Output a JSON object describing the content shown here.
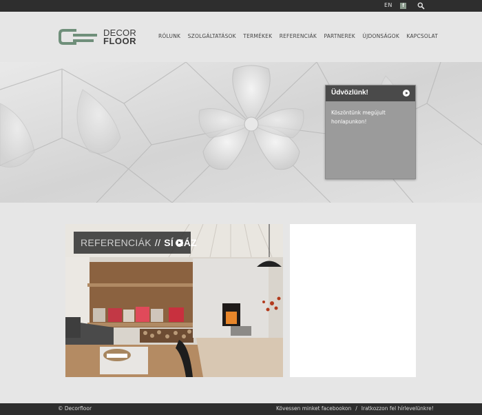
{
  "topbar": {
    "language": "EN",
    "facebook_glyph": "f",
    "icons": [
      "facebook-icon",
      "search-icon"
    ]
  },
  "brand": {
    "line1": "DECOR",
    "line2": "FLOOR",
    "mark_color": "#6f8f7a"
  },
  "nav": {
    "items": [
      "RÓLUNK",
      "SZOLGÁLTATÁSOK",
      "TERMÉKEK",
      "REFERENCIÁK",
      "PARTNEREK",
      "ÚJDONSÁGOK",
      "KAPCSOLAT"
    ]
  },
  "welcome": {
    "title": "Üdvözlünk!",
    "body": "Köszöntünk megújult honlapunkon!"
  },
  "reference": {
    "label": "REFERENCIÁK",
    "separator": "//",
    "title": "SÍ HÁZ"
  },
  "footer": {
    "copyright": "© Decorfloor",
    "link1": "Kövessen minket facebookon",
    "divider": "/",
    "link2": "Iratkozzon fel hírlevelünkre!"
  },
  "colors": {
    "topbar": "#2e2e2e",
    "background": "#e6e6e6",
    "welcome_panel": "#9b9b9b",
    "welcome_header": "#4a4a4a"
  }
}
